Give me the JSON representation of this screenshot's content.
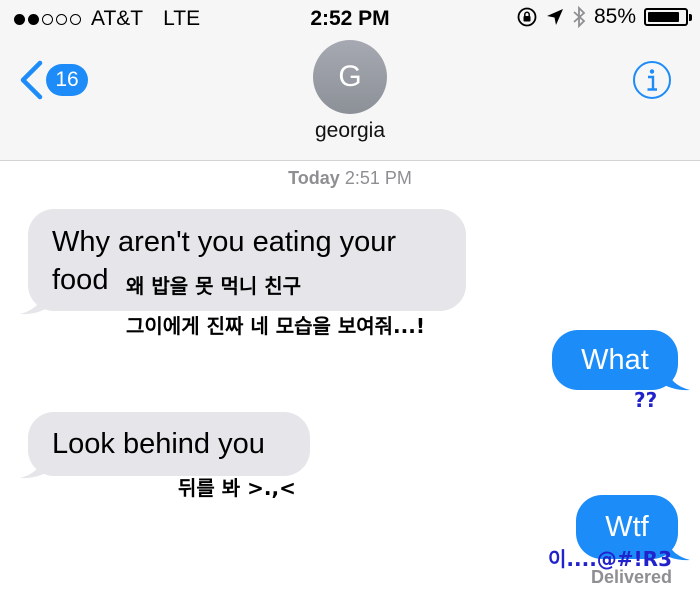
{
  "status_bar": {
    "carrier": "AT&T",
    "network": "LTE",
    "time": "2:52 PM",
    "battery": "85%"
  },
  "nav": {
    "back_count": "16",
    "contact_initial": "G",
    "contact_name": "georgia"
  },
  "thread": {
    "timestamp_day": "Today",
    "timestamp_time": "2:51 PM",
    "messages": [
      {
        "from": "them",
        "line1": "Why aren't you eating your",
        "line2": "food"
      },
      {
        "from": "me",
        "text": "What"
      },
      {
        "from": "them",
        "text": "Look behind you"
      },
      {
        "from": "me",
        "text": "Wtf"
      }
    ],
    "delivered": "Delivered"
  },
  "annotations": {
    "a1_line1": "왜 밥을 못 먹니 친구",
    "a1_line2": "그이에게 진짜 네 모습을 보여줘...!",
    "a2": "??",
    "a3": "뒤를 봐 >.,<",
    "a4": "이....@#!R3"
  },
  "colors": {
    "sent_bubble": "#1c8cf9",
    "received_bubble": "#e5e5ea",
    "ios_blue": "#1d8cf8",
    "annotation_blue": "#2222cc"
  }
}
